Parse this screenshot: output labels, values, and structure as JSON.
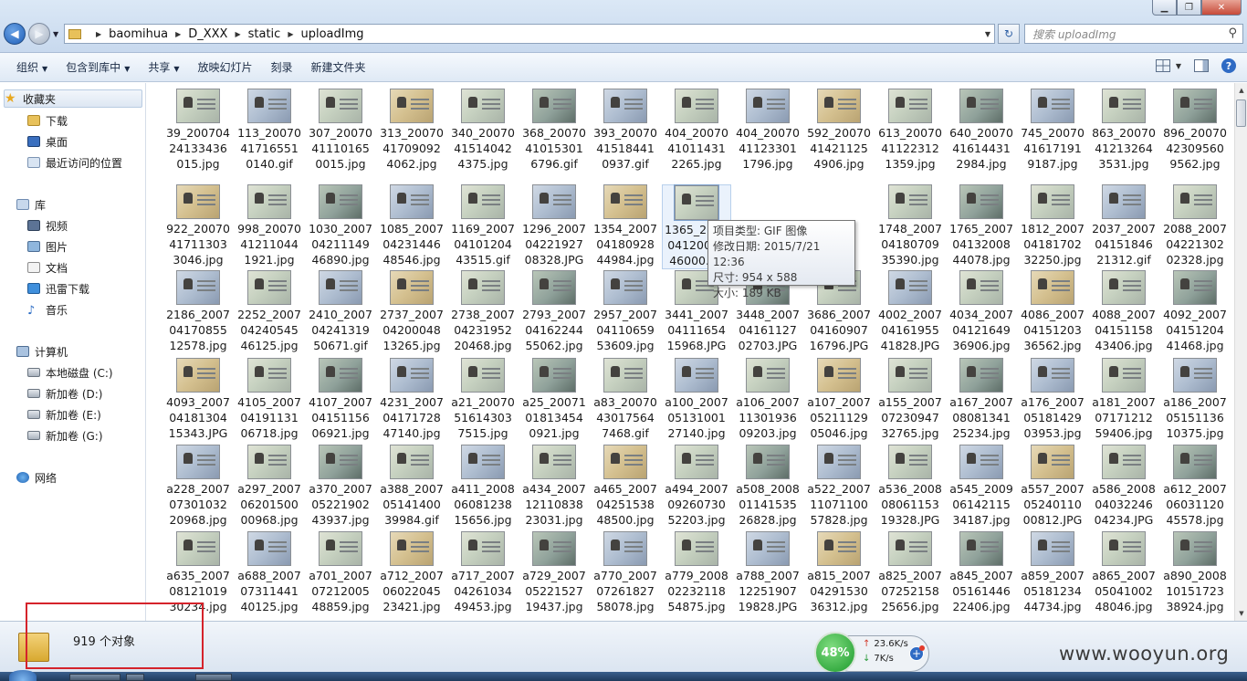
{
  "window": {
    "min_icon": "minimize-icon",
    "max_icon": "maximize-icon",
    "close_icon": "close-icon",
    "min_glyph": "▁",
    "max_glyph": "❐",
    "close_glyph": "✕"
  },
  "address": {
    "crumbs": [
      "baomihua",
      "D_XXX",
      "static",
      "uploadImg"
    ]
  },
  "search": {
    "placeholder": "搜索 uploadImg"
  },
  "toolbar": {
    "items": [
      "组织",
      "包含到库中",
      "共享",
      "放映幻灯片",
      "刻录",
      "新建文件夹"
    ]
  },
  "nav": {
    "favorites": "收藏夹",
    "downloads": "下载",
    "desktop": "桌面",
    "recent": "最近访问的位置",
    "library": "库",
    "videos": "视频",
    "pictures": "图片",
    "documents": "文档",
    "thunder": "迅雷下载",
    "music": "音乐",
    "computer": "计算机",
    "disk_c": "本地磁盘 (C:)",
    "disk_d": "新加卷 (D:)",
    "disk_e": "新加卷 (E:)",
    "disk_g": "新加卷 (G:)",
    "network": "网络"
  },
  "files": [
    [
      "39_200704",
      "24133436",
      "015.jpg"
    ],
    [
      "113_20070",
      "41716551",
      "0140.gif"
    ],
    [
      "307_20070",
      "41110165",
      "0015.jpg"
    ],
    [
      "313_20070",
      "41709092",
      "4062.jpg"
    ],
    [
      "340_20070",
      "41514042",
      "4375.jpg"
    ],
    [
      "368_20070",
      "41015301",
      "6796.gif"
    ],
    [
      "393_20070",
      "41518441",
      "0937.gif"
    ],
    [
      "404_20070",
      "41011431",
      "2265.jpg"
    ],
    [
      "404_20070",
      "41123301",
      "1796.jpg"
    ],
    [
      "592_20070",
      "41421125",
      "4906.jpg"
    ],
    [
      "613_20070",
      "41122312",
      "1359.jpg"
    ],
    [
      "640_20070",
      "41614431",
      "2984.jpg"
    ],
    [
      "745_20070",
      "41617191",
      "9187.jpg"
    ],
    [
      "863_20070",
      "41213264",
      "3531.jpg"
    ],
    [
      "896_20070",
      "42309560",
      "9562.jpg"
    ],
    [
      "922_20070",
      "41711303",
      "3046.jpg"
    ],
    [
      "998_20070",
      "41211044",
      "1921.jpg"
    ],
    [
      "1030_2007",
      "04211149",
      "46890.jpg"
    ],
    [
      "1085_2007",
      "04231446",
      "48546.jpg"
    ],
    [
      "1169_2007",
      "04101204",
      "43515.gif"
    ],
    [
      "1296_2007",
      "04221927",
      "08328.JPG"
    ],
    [
      "1354_2007",
      "04180928",
      "44984.jpg"
    ],
    [
      "1365_2007",
      "04120026",
      "46000.gif"
    ],
    [
      "",
      "",
      ""
    ],
    [
      "",
      "",
      ""
    ],
    [
      "1748_2007",
      "04180709",
      "35390.jpg"
    ],
    [
      "1765_2007",
      "04132008",
      "44078.jpg"
    ],
    [
      "1812_2007",
      "04181702",
      "32250.jpg"
    ],
    [
      "2037_2007",
      "04151846",
      "21312.gif"
    ],
    [
      "2088_2007",
      "04221302",
      "02328.jpg"
    ],
    [
      "2186_2007",
      "04170855",
      "12578.jpg"
    ],
    [
      "2252_2007",
      "04240545",
      "46125.jpg"
    ],
    [
      "2410_2007",
      "04241319",
      "50671.gif"
    ],
    [
      "2737_2007",
      "04200048",
      "13265.jpg"
    ],
    [
      "2738_2007",
      "04231952",
      "20468.jpg"
    ],
    [
      "2793_2007",
      "04162244",
      "55062.jpg"
    ],
    [
      "2957_2007",
      "04110659",
      "53609.jpg"
    ],
    [
      "3441_2007",
      "04111654",
      "15968.JPG"
    ],
    [
      "3448_2007",
      "04161127",
      "02703.JPG"
    ],
    [
      "3686_2007",
      "04160907",
      "16796.JPG"
    ],
    [
      "4002_2007",
      "04161955",
      "41828.JPG"
    ],
    [
      "4034_2007",
      "04121649",
      "36906.jpg"
    ],
    [
      "4086_2007",
      "04151203",
      "36562.jpg"
    ],
    [
      "4088_2007",
      "04151158",
      "43406.jpg"
    ],
    [
      "4092_2007",
      "04151204",
      "41468.jpg"
    ],
    [
      "4093_2007",
      "04181304",
      "15343.JPG"
    ],
    [
      "4105_2007",
      "04191131",
      "06718.jpg"
    ],
    [
      "4107_2007",
      "04151156",
      "06921.jpg"
    ],
    [
      "4231_2007",
      "04171728",
      "47140.jpg"
    ],
    [
      "a21_20070",
      "51614303",
      "7515.jpg"
    ],
    [
      "a25_20071",
      "01813454",
      "0921.jpg"
    ],
    [
      "a83_20070",
      "43017564",
      "7468.gif"
    ],
    [
      "a100_2007",
      "05131001",
      "27140.jpg"
    ],
    [
      "a106_2007",
      "11301936",
      "09203.jpg"
    ],
    [
      "a107_2007",
      "05211129",
      "05046.jpg"
    ],
    [
      "a155_2007",
      "07230947",
      "32765.jpg"
    ],
    [
      "a167_2007",
      "08081341",
      "25234.jpg"
    ],
    [
      "a176_2007",
      "05181429",
      "03953.jpg"
    ],
    [
      "a181_2007",
      "07171212",
      "59406.jpg"
    ],
    [
      "a186_2007",
      "05151136",
      "10375.jpg"
    ],
    [
      "a228_2007",
      "07301032",
      "20968.jpg"
    ],
    [
      "a297_2007",
      "06201500",
      "00968.jpg"
    ],
    [
      "a370_2007",
      "05221902",
      "43937.jpg"
    ],
    [
      "a388_2007",
      "05141400",
      "39984.gif"
    ],
    [
      "a411_2008",
      "06081238",
      "15656.jpg"
    ],
    [
      "a434_2007",
      "12110838",
      "23031.jpg"
    ],
    [
      "a465_2007",
      "04251538",
      "48500.jpg"
    ],
    [
      "a494_2007",
      "09260730",
      "52203.jpg"
    ],
    [
      "a508_2008",
      "01141535",
      "26828.jpg"
    ],
    [
      "a522_2007",
      "11071100",
      "57828.jpg"
    ],
    [
      "a536_2008",
      "08061153",
      "19328.JPG"
    ],
    [
      "a545_2009",
      "06142115",
      "34187.jpg"
    ],
    [
      "a557_2007",
      "05240110",
      "00812.JPG"
    ],
    [
      "a586_2008",
      "04032246",
      "04234.JPG"
    ],
    [
      "a612_2007",
      "06031120",
      "45578.jpg"
    ],
    [
      "a635_2007",
      "08121019",
      "30234.jpg"
    ],
    [
      "a688_2007",
      "07311441",
      "40125.jpg"
    ],
    [
      "a701_2007",
      "07212005",
      "48859.jpg"
    ],
    [
      "a712_2007",
      "06022045",
      "23421.jpg"
    ],
    [
      "a717_2007",
      "04261034",
      "49453.jpg"
    ],
    [
      "a729_2007",
      "05221527",
      "19437.jpg"
    ],
    [
      "a770_2007",
      "07261827",
      "58078.jpg"
    ],
    [
      "a779_2008",
      "02232118",
      "54875.jpg"
    ],
    [
      "a788_2007",
      "12251907",
      "19828.JPG"
    ],
    [
      "a815_2007",
      "04291530",
      "36312.jpg"
    ],
    [
      "a825_2007",
      "07252158",
      "25656.jpg"
    ],
    [
      "a845_2007",
      "05161446",
      "22406.jpg"
    ],
    [
      "a859_2007",
      "05181234",
      "44734.jpg"
    ],
    [
      "a865_2007",
      "05041002",
      "48046.jpg"
    ],
    [
      "a890_2008",
      "10151723",
      "38924.jpg"
    ]
  ],
  "tooltip": {
    "type": "项目类型: GIF 图像",
    "modified": "修改日期: 2015/7/21 12:36",
    "dimensions": "尺寸: 954 x 588",
    "size": "大小: 189 KB"
  },
  "status": {
    "count": "919 个对象"
  },
  "speed": {
    "percent": "48%",
    "upload": "23.6K/s",
    "download": "7K/s"
  },
  "watermark": "www.wooyun.org",
  "colors": {
    "highlight_box": "#d5232b",
    "speed_green": "#1c9a2c",
    "accent_blue": "#2f6bc4"
  }
}
